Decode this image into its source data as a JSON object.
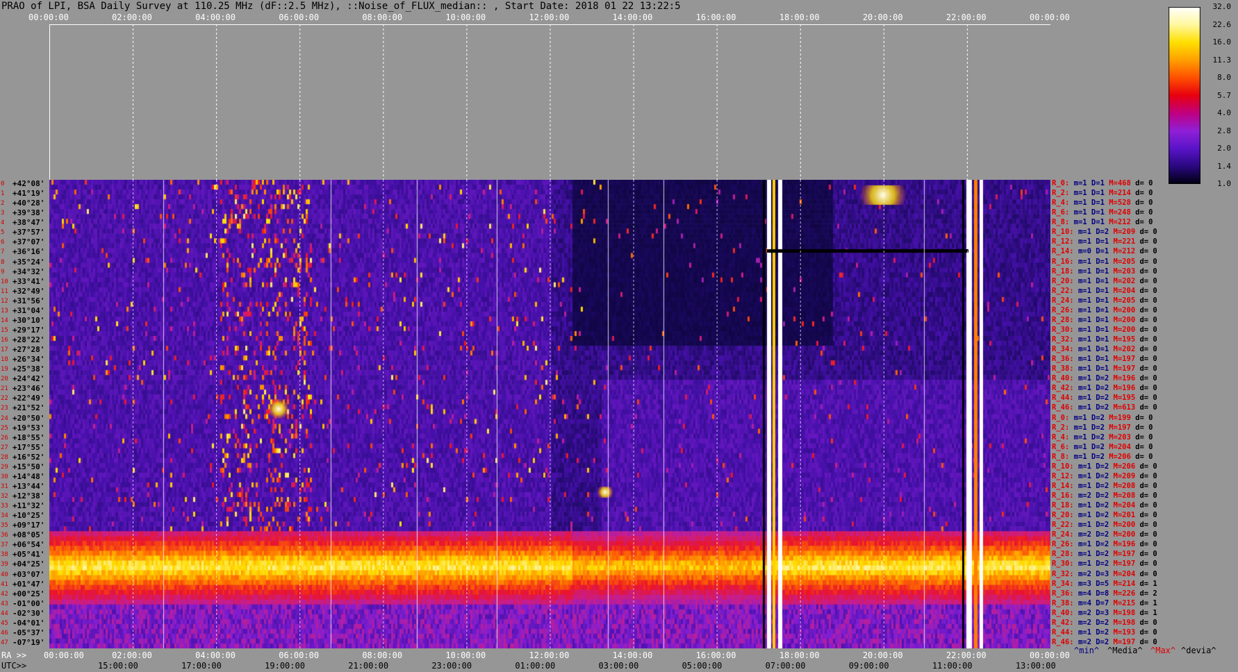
{
  "title": "PRAO of LPI, BSA Daily Survey at 110.25 MHz (dF::2.5 MHz), ::Noise_of_FLUX_median:: , Start Date: 2018 01 22 13:22:5",
  "top_axis_ticks": [
    "00:00:00",
    "02:00:00",
    "04:00:00",
    "06:00:00",
    "08:00:00",
    "10:00:00",
    "12:00:00",
    "14:00:00",
    "16:00:00",
    "18:00:00",
    "20:00:00",
    "22:00:00",
    "00:00:00"
  ],
  "bottom_axis": {
    "ra_prefix": "RA >>",
    "ra_ticks": [
      "00:00:00",
      "02:00:00",
      "04:00:00",
      "06:00:00",
      "08:00:00",
      "10:00:00",
      "12:00:00",
      "14:00:00",
      "16:00:00",
      "18:00:00",
      "20:00:00",
      "22:00:00",
      "00:00:00"
    ],
    "utc_prefix": "UTC>>",
    "utc_ticks": [
      "15:00:00",
      "17:00:00",
      "19:00:00",
      "21:00:00",
      "23:00:00",
      "01:00:00",
      "03:00:00",
      "05:00:00",
      "07:00:00",
      "09:00:00",
      "11:00:00",
      "13:00:00"
    ]
  },
  "colorbar": {
    "ticks": [
      "32.0",
      "22.6",
      "16.0",
      "11.3",
      "8.0",
      "5.7",
      "4.0",
      "2.8",
      "2.0",
      "1.4",
      "1.0"
    ],
    "colors": [
      "#ffffff",
      "#fff8a0",
      "#ffe000",
      "#ffa000",
      "#ff5000",
      "#e80010",
      "#c00080",
      "#9020d8",
      "#5a14c8",
      "#2a0880",
      "#000010"
    ]
  },
  "declinations": [
    "+42°08'",
    "+41°19'",
    "+40°28'",
    "+39°38'",
    "+38°47'",
    "+37°57'",
    "+37°07'",
    "+36°16'",
    "+35°24'",
    "+34°32'",
    "+33°41'",
    "+32°49'",
    "+31°56'",
    "+31°04'",
    "+30°10'",
    "+29°17'",
    "+28°22'",
    "+27°28'",
    "+26°34'",
    "+25°38'",
    "+24°42'",
    "+23°46'",
    "+22°49'",
    "+21°52'",
    "+20°50'",
    "+19°53'",
    "+18°55'",
    "+17°55'",
    "+16°52'",
    "+15°50'",
    "+14°48'",
    "+13°44'",
    "+12°38'",
    "+11°32'",
    "+10°25'",
    "+09°17'",
    "+08°05'",
    "+06°54'",
    "+05°41'",
    "+04°25'",
    "+03°07'",
    "+01°47'",
    "+00°25'",
    "-01°00'",
    "-02°30'",
    "-04°01'",
    "-05°37'",
    "-07°19'"
  ],
  "row_indices": [
    "0",
    "1",
    "2",
    "3",
    "4",
    "5",
    "6",
    "7",
    "8",
    "9",
    "10",
    "11",
    "12",
    "13",
    "14",
    "15",
    "16",
    "17",
    "18",
    "19",
    "20",
    "21",
    "22",
    "23",
    "24",
    "25",
    "26",
    "27",
    "28",
    "29",
    "30",
    "31",
    "32",
    "33",
    "34",
    "35",
    "36",
    "37",
    "38",
    "39",
    "40",
    "41",
    "42",
    "43",
    "44",
    "45",
    "46",
    "47"
  ],
  "receivers": [
    {
      "r": "R_0:",
      "m": "m=1",
      "d": "D=1",
      "mx": "M=468",
      "dv": "d= 0"
    },
    {
      "r": "R_2:",
      "m": "m=1",
      "d": "D=1",
      "mx": "M=214",
      "dv": "d= 0"
    },
    {
      "r": "R_4:",
      "m": "m=1",
      "d": "D=1",
      "mx": "M=528",
      "dv": "d= 0"
    },
    {
      "r": "R_6:",
      "m": "m=1",
      "d": "D=1",
      "mx": "M=248",
      "dv": "d= 0"
    },
    {
      "r": "R_8:",
      "m": "m=1",
      "d": "D=1",
      "mx": "M=212",
      "dv": "d= 0"
    },
    {
      "r": "R_10:",
      "m": "m=1",
      "d": "D=2",
      "mx": "M=209",
      "dv": "d= 0"
    },
    {
      "r": "R_12:",
      "m": "m=1",
      "d": "D=1",
      "mx": "M=221",
      "dv": "d= 0"
    },
    {
      "r": "R_14:",
      "m": "m=0",
      "d": "D=1",
      "mx": "M=212",
      "dv": "d= 0"
    },
    {
      "r": "R_16:",
      "m": "m=1",
      "d": "D=1",
      "mx": "M=205",
      "dv": "d= 0"
    },
    {
      "r": "R_18:",
      "m": "m=1",
      "d": "D=1",
      "mx": "M=203",
      "dv": "d= 0"
    },
    {
      "r": "R_20:",
      "m": "m=1",
      "d": "D=1",
      "mx": "M=202",
      "dv": "d= 0"
    },
    {
      "r": "R_22:",
      "m": "m=1",
      "d": "D=1",
      "mx": "M=204",
      "dv": "d= 0"
    },
    {
      "r": "R_24:",
      "m": "m=1",
      "d": "D=1",
      "mx": "M=205",
      "dv": "d= 0"
    },
    {
      "r": "R_26:",
      "m": "m=1",
      "d": "D=1",
      "mx": "M=200",
      "dv": "d= 0"
    },
    {
      "r": "R_28:",
      "m": "m=1",
      "d": "D=1",
      "mx": "M=200",
      "dv": "d= 0"
    },
    {
      "r": "R_30:",
      "m": "m=1",
      "d": "D=1",
      "mx": "M=200",
      "dv": "d= 0"
    },
    {
      "r": "R_32:",
      "m": "m=1",
      "d": "D=1",
      "mx": "M=195",
      "dv": "d= 0"
    },
    {
      "r": "R_34:",
      "m": "m=1",
      "d": "D=1",
      "mx": "M=202",
      "dv": "d= 0"
    },
    {
      "r": "R_36:",
      "m": "m=1",
      "d": "D=1",
      "mx": "M=197",
      "dv": "d= 0"
    },
    {
      "r": "R_38:",
      "m": "m=1",
      "d": "D=1",
      "mx": "M=197",
      "dv": "d= 0"
    },
    {
      "r": "R_40:",
      "m": "m=1",
      "d": "D=2",
      "mx": "M=196",
      "dv": "d= 0"
    },
    {
      "r": "R_42:",
      "m": "m=1",
      "d": "D=2",
      "mx": "M=196",
      "dv": "d= 0"
    },
    {
      "r": "R_44:",
      "m": "m=1",
      "d": "D=2",
      "mx": "M=195",
      "dv": "d= 0"
    },
    {
      "r": "R_46:",
      "m": "m=1",
      "d": "D=2",
      "mx": "M=613",
      "dv": "d= 0"
    },
    {
      "r": "R_0:",
      "m": "m=1",
      "d": "D=2",
      "mx": "M=199",
      "dv": "d= 0"
    },
    {
      "r": "R_2:",
      "m": "m=1",
      "d": "D=2",
      "mx": "M=197",
      "dv": "d= 0"
    },
    {
      "r": "R_4:",
      "m": "m=1",
      "d": "D=2",
      "mx": "M=203",
      "dv": "d= 0"
    },
    {
      "r": "R_6:",
      "m": "m=1",
      "d": "D=2",
      "mx": "M=204",
      "dv": "d= 0"
    },
    {
      "r": "R_8:",
      "m": "m=1",
      "d": "D=2",
      "mx": "M=206",
      "dv": "d= 0"
    },
    {
      "r": "R_10:",
      "m": "m=1",
      "d": "D=2",
      "mx": "M=206",
      "dv": "d= 0"
    },
    {
      "r": "R_12:",
      "m": "m=1",
      "d": "D=2",
      "mx": "M=209",
      "dv": "d= 0"
    },
    {
      "r": "R_14:",
      "m": "m=1",
      "d": "D=2",
      "mx": "M=208",
      "dv": "d= 0"
    },
    {
      "r": "R_16:",
      "m": "m=2",
      "d": "D=2",
      "mx": "M=208",
      "dv": "d= 0"
    },
    {
      "r": "R_18:",
      "m": "m=1",
      "d": "D=2",
      "mx": "M=204",
      "dv": "d= 0"
    },
    {
      "r": "R_20:",
      "m": "m=1",
      "d": "D=2",
      "mx": "M=201",
      "dv": "d= 0"
    },
    {
      "r": "R_22:",
      "m": "m=1",
      "d": "D=2",
      "mx": "M=200",
      "dv": "d= 0"
    },
    {
      "r": "R_24:",
      "m": "m=2",
      "d": "D=2",
      "mx": "M=200",
      "dv": "d= 0"
    },
    {
      "r": "R_26:",
      "m": "m=1",
      "d": "D=2",
      "mx": "M=196",
      "dv": "d= 0"
    },
    {
      "r": "R_28:",
      "m": "m=1",
      "d": "D=2",
      "mx": "M=197",
      "dv": "d= 0"
    },
    {
      "r": "R_30:",
      "m": "m=1",
      "d": "D=2",
      "mx": "M=197",
      "dv": "d= 0"
    },
    {
      "r": "R_32:",
      "m": "m=2",
      "d": "D=3",
      "mx": "M=204",
      "dv": "d= 0"
    },
    {
      "r": "R_34:",
      "m": "m=3",
      "d": "D=5",
      "mx": "M=214",
      "dv": "d= 1"
    },
    {
      "r": "R_36:",
      "m": "m=4",
      "d": "D=8",
      "mx": "M=226",
      "dv": "d= 2"
    },
    {
      "r": "R_38:",
      "m": "m=4",
      "d": "D=7",
      "mx": "M=215",
      "dv": "d= 1"
    },
    {
      "r": "R_40:",
      "m": "m=2",
      "d": "D=3",
      "mx": "M=198",
      "dv": "d= 1"
    },
    {
      "r": "R_42:",
      "m": "m=2",
      "d": "D=2",
      "mx": "M=198",
      "dv": "d= 0"
    },
    {
      "r": "R_44:",
      "m": "m=1",
      "d": "D=2",
      "mx": "M=193",
      "dv": "d= 0"
    },
    {
      "r": "R_46:",
      "m": "m=2",
      "d": "D=2",
      "mx": "M=197",
      "dv": "d= 0"
    }
  ],
  "legend": {
    "min": "^min^",
    "median": "^Media^",
    "max": "^Max^",
    "dev": "^devia^"
  },
  "colors": {
    "min": "#000080",
    "median": "#000000",
    "max": "#e00000",
    "dev": "#000000",
    "background": "#969696"
  },
  "chart_data": {
    "type": "heatmap",
    "title": "PRAO of LPI, BSA Daily Survey at 110.25 MHz (dF::2.5 MHz), ::Noise_of_FLUX_median:: , Start Date: 2018 01 22 13:22:5",
    "x_ticks_ra": [
      "00:00:00",
      "02:00:00",
      "04:00:00",
      "06:00:00",
      "08:00:00",
      "10:00:00",
      "12:00:00",
      "14:00:00",
      "16:00:00",
      "18:00:00",
      "20:00:00",
      "22:00:00",
      "00:00:00"
    ],
    "x_ticks_utc": [
      "15:00:00",
      "17:00:00",
      "19:00:00",
      "21:00:00",
      "23:00:00",
      "01:00:00",
      "03:00:00",
      "05:00:00",
      "07:00:00",
      "09:00:00",
      "11:00:00",
      "13:00:00"
    ],
    "y_ticks": "declinations +42°08' to -07°19' (48 rows)",
    "colorbar_range": [
      1.0,
      32.0
    ],
    "colorbar_scale": "log",
    "grid": true
  }
}
